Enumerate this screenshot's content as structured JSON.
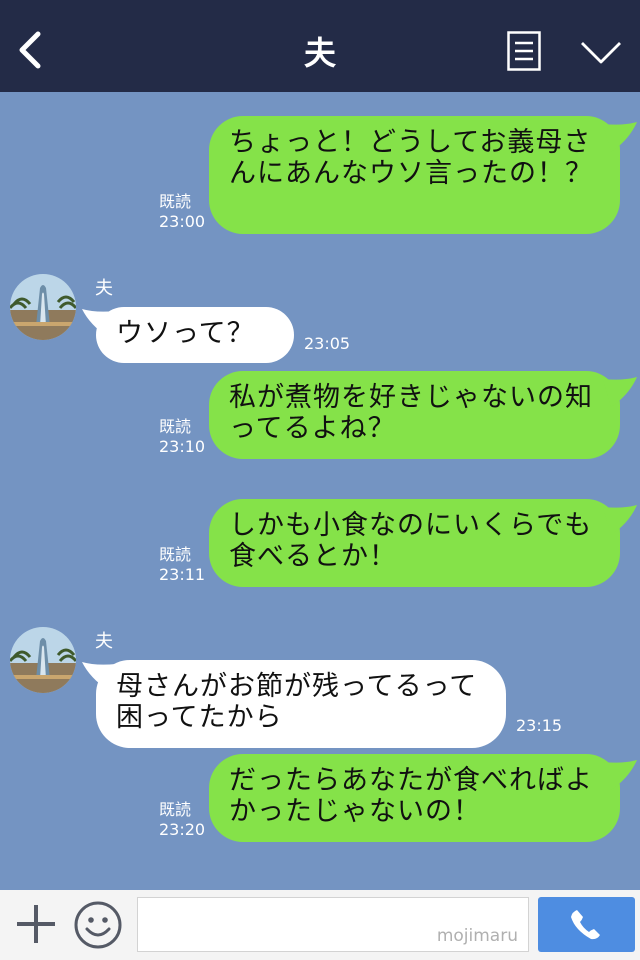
{
  "header": {
    "title": "夫"
  },
  "messages": [
    {
      "from": "me",
      "text": "ちょっと！どうしてお義母さんにあんなウソ言ったの！？",
      "read": "既読",
      "time": "23:00"
    },
    {
      "from": "them",
      "sender": "夫",
      "text": "ウソって？",
      "time": "23:05"
    },
    {
      "from": "me",
      "text": "私が煮物を好きじゃないの知ってるよね？",
      "read": "既読",
      "time": "23:10"
    },
    {
      "from": "me",
      "text": "しかも小食なのにいくらでも食べるとか！",
      "read": "既読",
      "time": "23:11"
    },
    {
      "from": "them",
      "sender": "夫",
      "text": "母さんがお節が残ってるって困ってたから",
      "time": "23:15"
    },
    {
      "from": "me",
      "text": "だったらあなたが食べればよかったじゃないの！",
      "read": "既読",
      "time": "23:20"
    }
  ],
  "footer": {
    "watermark": "mojimaru"
  },
  "colors": {
    "header": "#232b47",
    "chat_bg": "#7494c2",
    "my_bubble": "#85e249",
    "their_bubble": "#ffffff",
    "send": "#4e8de1"
  },
  "icons": {
    "back": "chevron-left-icon",
    "menu": "list-icon",
    "collapse": "chevron-down-icon",
    "add": "plus-icon",
    "sticker": "smiley-icon",
    "send": "phone-icon"
  }
}
